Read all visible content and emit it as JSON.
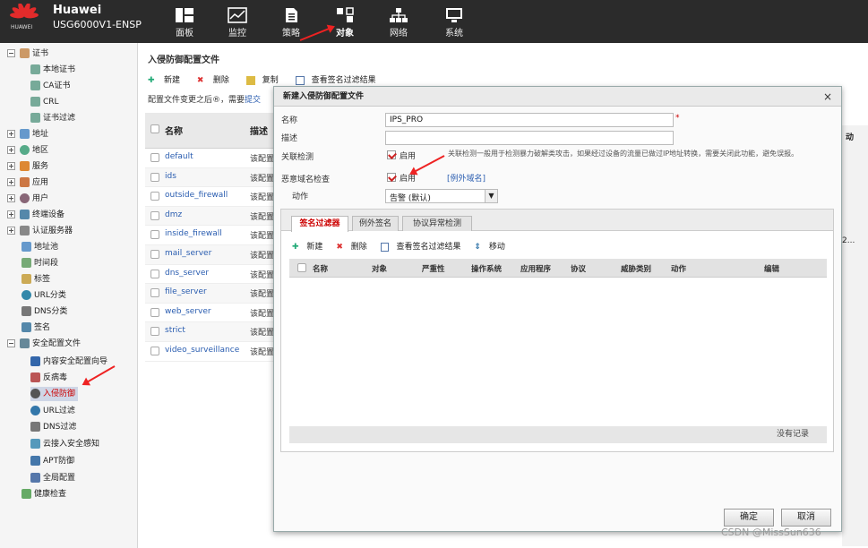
{
  "header": {
    "brand_line1": "Huawei",
    "brand_line2": "USG6000V1-ENSP",
    "logo_text": "HUAWEI",
    "nav": [
      {
        "label": "面板",
        "icon": "dashboard-icon"
      },
      {
        "label": "监控",
        "icon": "monitor-icon"
      },
      {
        "label": "策略",
        "icon": "policy-icon"
      },
      {
        "label": "对象",
        "icon": "object-icon"
      },
      {
        "label": "网络",
        "icon": "network-icon"
      },
      {
        "label": "系统",
        "icon": "system-icon"
      }
    ]
  },
  "sidebar": {
    "items": [
      {
        "label": "证书"
      },
      {
        "label": "本地证书"
      },
      {
        "label": "CA证书"
      },
      {
        "label": "CRL"
      },
      {
        "label": "证书过滤"
      },
      {
        "label": "地址"
      },
      {
        "label": "地区"
      },
      {
        "label": "服务"
      },
      {
        "label": "应用"
      },
      {
        "label": "用户"
      },
      {
        "label": "终端设备"
      },
      {
        "label": "认证服务器"
      },
      {
        "label": "地址池"
      },
      {
        "label": "时间段"
      },
      {
        "label": "标签"
      },
      {
        "label": "URL分类"
      },
      {
        "label": "DNS分类"
      },
      {
        "label": "签名"
      },
      {
        "label": "安全配置文件"
      },
      {
        "label": "内容安全配置向导"
      },
      {
        "label": "反病毒"
      },
      {
        "label": "入侵防御"
      },
      {
        "label": "URL过滤"
      },
      {
        "label": "DNS过滤"
      },
      {
        "label": "云接入安全感知"
      },
      {
        "label": "APT防御"
      },
      {
        "label": "全局配置"
      },
      {
        "label": "健康检查"
      }
    ]
  },
  "main": {
    "title": "入侵防御配置文件",
    "toolbar": {
      "add": "新建",
      "delete": "删除",
      "copy": "复制",
      "view": "查看签名过滤结果"
    },
    "notice": "配置文件变更之后®，需要",
    "notice_link": "提交",
    "table": {
      "col_name": "名称",
      "col_desc": "描述",
      "rows": [
        {
          "name": "default",
          "desc": "该配置"
        },
        {
          "name": "ids",
          "desc": "该配置"
        },
        {
          "name": "outside_firewall",
          "desc": "该配置"
        },
        {
          "name": "dmz",
          "desc": "该配置"
        },
        {
          "name": "inside_firewall",
          "desc": "该配置"
        },
        {
          "name": "mail_server",
          "desc": "该配置"
        },
        {
          "name": "dns_server",
          "desc": "该配置"
        },
        {
          "name": "file_server",
          "desc": "该配置"
        },
        {
          "name": "web_server",
          "desc": "该配置"
        },
        {
          "name": "strict",
          "desc": "该配置"
        },
        {
          "name": "video_surveillance",
          "desc": "该配置"
        }
      ]
    },
    "right_col_head": "动",
    "right_col_cell": "2..."
  },
  "dialog": {
    "title": "新建入侵防御配置文件",
    "close": "×",
    "name_label": "名称",
    "name_value": "IPS_PRO",
    "required": "*",
    "desc_label": "描述",
    "desc_value": "",
    "assoc_label": "关联检测",
    "assoc_check": "启用",
    "assoc_hint": "关联检测一般用于检测暴力破解类攻击，如果经过设备的流量已做过IP地址转换，需要关闭此功能，避免误报。",
    "domain_label": "恶意域名检查",
    "domain_check": "启用",
    "domain_link": "[例外域名]",
    "action_label": "动作",
    "action_value": "告警 (默认)",
    "tabs": [
      "签名过滤器",
      "例外签名",
      "协议异常检测"
    ],
    "inner_toolbar": {
      "add": "新建",
      "delete": "删除",
      "view": "查看签名过滤结果",
      "move": "移动"
    },
    "grid_cols": [
      "名称",
      "对象",
      "严重性",
      "操作系统",
      "应用程序",
      "协议",
      "威胁类别",
      "动作",
      "编辑"
    ],
    "no_records": "没有记录",
    "ok": "确定",
    "cancel": "取消"
  },
  "watermark": "CSDN @MissSun636",
  "colors": {
    "accent": "#c00000",
    "link": "#2a5db0",
    "topbar": "#2b2b2b"
  }
}
